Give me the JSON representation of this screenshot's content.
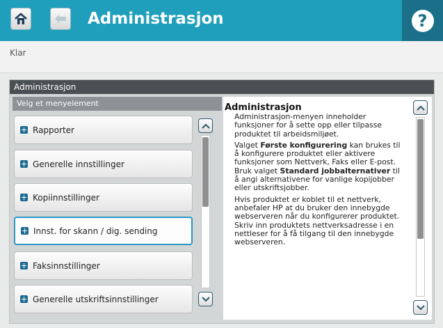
{
  "header": {
    "title": "Administrasjon",
    "home_icon": "home-icon",
    "back_icon": "back-arrow-icon",
    "help_label": "?"
  },
  "status": "Klar",
  "panel": {
    "title": "Administrasjon",
    "list_header": "Velg et menyelement",
    "items": [
      {
        "label": "Rapporter"
      },
      {
        "label": "Generelle innstillinger"
      },
      {
        "label": "Kopiinnstillinger"
      },
      {
        "label": "Innst. for skann / dig. sending"
      },
      {
        "label": "Faksinnstillinger"
      },
      {
        "label": "Generelle utskriftsinnstillinger"
      }
    ],
    "selected_index": 3
  },
  "description": {
    "title": "Administrasjon",
    "p1": "Administrasjon-menyen inneholder funksjoner for å sette opp eller tilpasse produktet til arbeidsmiljøet.",
    "p2_a": "Valget ",
    "p2_b1": "Første konfigurering",
    "p2_c": " kan brukes til å konfigurere produktet eller aktivere funksjoner som Nettverk, Faks eller E-post. Bruk valget ",
    "p2_b2": "Standard jobbalternativer",
    "p2_d": " til å angi alternativene for vanlige kopijobber eller utskriftsjobber.",
    "p3": "Hvis produktet er koblet til et nettverk, anbefaler HP at du bruker den innebygde webserveren når du konfigurerer produktet. Skriv inn produktets nettverksadresse i en nettleser for å få tilgang til den innebygde webserveren."
  },
  "colors": {
    "accent": "#1f9fbc",
    "accent_dark": "#1b6f88",
    "selected_border": "#2b96c4"
  }
}
